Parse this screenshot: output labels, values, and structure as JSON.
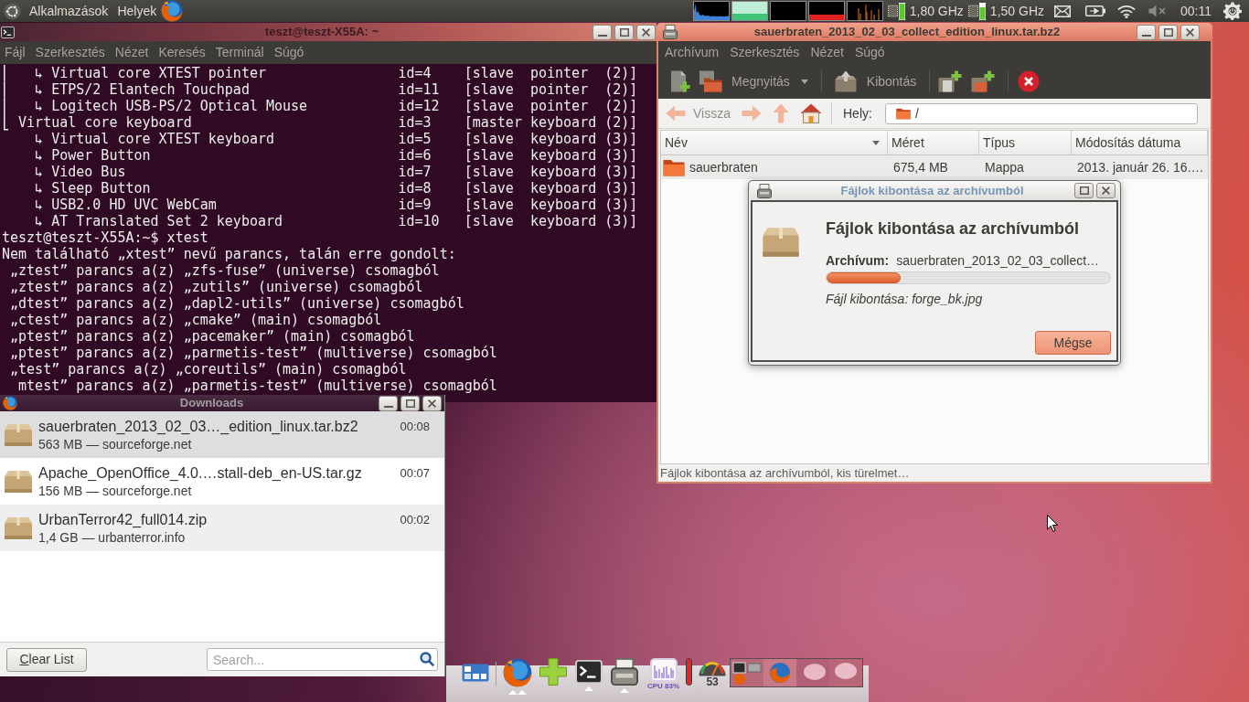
{
  "top_panel": {
    "menus": [
      "Alkalmazások",
      "Helyek"
    ],
    "cpu_frequencies": [
      "1,80 GHz",
      "1,50 GHz"
    ],
    "clock": "00:11"
  },
  "terminal_window": {
    "title": "teszt@teszt-X55A: ~",
    "menu": [
      "Fájl",
      "Szerkesztés",
      "Nézet",
      "Keresés",
      "Terminál",
      "Súgó"
    ],
    "devices": [
      {
        "kind": "slave",
        "branch": "⎜",
        "name": "↳ Virtual core XTEST pointer",
        "id": "id=4",
        "role": "[slave  pointer  (2)]"
      },
      {
        "kind": "slave",
        "branch": "⎜",
        "name": "↳ ETPS/2 Elantech Touchpad",
        "id": "id=11",
        "role": "[slave  pointer  (2)]"
      },
      {
        "kind": "slave",
        "branch": "⎜",
        "name": "↳ Logitech USB-PS/2 Optical Mouse",
        "id": "id=12",
        "role": "[slave  pointer  (2)]"
      },
      {
        "kind": "master",
        "branch": "⎣",
        "name": "Virtual core keyboard",
        "id": "id=3",
        "role": "[master keyboard (2)]"
      },
      {
        "kind": "slave",
        "name": "↳ Virtual core XTEST keyboard",
        "id": "id=5",
        "role": "[slave  keyboard (3)]"
      },
      {
        "kind": "slave",
        "name": "↳ Power Button",
        "id": "id=6",
        "role": "[slave  keyboard (3)]"
      },
      {
        "kind": "slave",
        "name": "↳ Video Bus",
        "id": "id=7",
        "role": "[slave  keyboard (3)]"
      },
      {
        "kind": "slave",
        "name": "↳ Sleep Button",
        "id": "id=8",
        "role": "[slave  keyboard (3)]"
      },
      {
        "kind": "slave",
        "name": "↳ USB2.0 HD UVC WebCam",
        "id": "id=9",
        "role": "[slave  keyboard (3)]"
      },
      {
        "kind": "slave",
        "name": "↳ AT Translated Set 2 keyboard",
        "id": "id=10",
        "role": "[slave  keyboard (3)]"
      }
    ],
    "prompt": "teszt@teszt-X55A:~$ xtest",
    "message": "Nem található „xtest” nevű parancs, talán erre gondolt:",
    "suggestions": [
      "„ztest” parancs a(z) „zfs-fuse” (universe) csomagból",
      "„ztest” parancs a(z) „zutils” (universe) csomagból",
      "„dtest” parancs a(z) „dapl2-utils” (universe) csomagból",
      "„ctest” parancs a(z) „cmake” (main) csomagból",
      "„ptest” parancs a(z) „pacemaker” (main) csomagból",
      "„ptest” parancs a(z) „parmetis-test” (multiverse) csomagból",
      "„test” parancs a(z) „coreutils” (main) csomagból"
    ],
    "last_line": "mtest” parancs a(z) „parmetis-test” (multiverse) csomagból"
  },
  "archive_window": {
    "title": "sauerbraten_2013_02_03_collect_edition_linux.tar.bz2",
    "menu": [
      "Archívum",
      "Szerkesztés",
      "Nézet",
      "Súgó"
    ],
    "toolbar": {
      "open": "Megnyitás",
      "extract": "Kibontás"
    },
    "back": {
      "label": "Vissza",
      "disabled": true
    },
    "location": {
      "label": "Hely:",
      "value": "/"
    },
    "columns": [
      {
        "label": "Név",
        "sorted": true
      },
      {
        "label": "Méret",
        "sorted": false
      },
      {
        "label": "Típus",
        "sorted": false
      },
      {
        "label": "Módosítás dátuma",
        "sorted": false
      }
    ],
    "rows": [
      {
        "name": "sauerbraten",
        "size": "675,4 MB",
        "type": "Mappa",
        "modified": "2013. január 26. 16.…"
      }
    ],
    "status": "Fájlok kibontása az archívumból, kis türelmet…"
  },
  "extract_dialog": {
    "title": "Fájlok kibontása az archívumból",
    "heading": "Fájlok kibontása az archívumból",
    "archive_label": "Archívum:",
    "archive_name": "sauerbraten_2013_02_03_collect…",
    "level": 0.26,
    "current_file": "Fájl kibontása: forge_bk.jpg",
    "cancel": "Mégse"
  },
  "downloads_window": {
    "title": "Downloads",
    "items": [
      {
        "name": "sauerbraten_2013_02_03…_edition_linux.tar.bz2",
        "details": "563 MB — sourceforge.net",
        "time": "00:08",
        "selected": true
      },
      {
        "name": "Apache_OpenOffice_4.0.…stall-deb_en-US.tar.gz",
        "details": "156 MB — sourceforge.net",
        "time": "00:07",
        "selected": false
      },
      {
        "name": "UrbanTerror42_full014.zip",
        "details": "1,4 GB — urbanterror.info",
        "time": "00:02",
        "selected": false
      }
    ],
    "clear_button": "Clear List",
    "search": {
      "placeholder": "Search..."
    }
  },
  "dock": {
    "launchers": [
      {
        "kind": "browser",
        "indicator": {
          "kind": "double"
        }
      },
      {
        "kind": "add"
      },
      {
        "kind": "terminal",
        "indicator": {
          "kind": "single"
        }
      },
      {
        "kind": "archiver",
        "indicator": {
          "kind": "single"
        }
      }
    ],
    "cpu_label": "CPU 83%",
    "gauge_reading": "53"
  }
}
